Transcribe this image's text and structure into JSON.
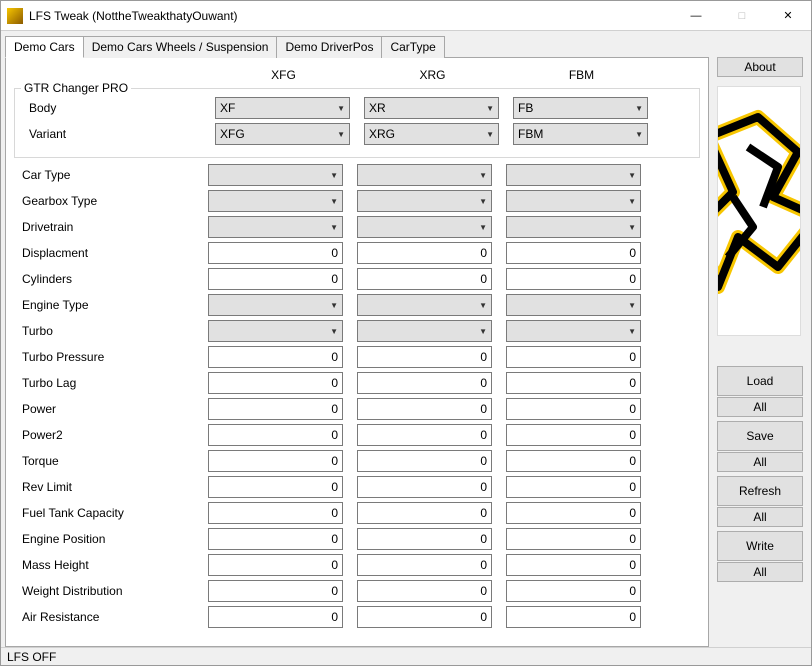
{
  "window": {
    "title": "LFS Tweak (NottheTweakthatyOuwant)"
  },
  "tabs": [
    "Demo Cars",
    "Demo Cars Wheels / Suspension",
    "Demo DriverPos",
    "CarType"
  ],
  "active_tab": 0,
  "columns": [
    "XFG",
    "XRG",
    "FBM"
  ],
  "group": {
    "title": "GTR Changer PRO",
    "rows": [
      {
        "label": "Body",
        "type": "combo",
        "values": [
          "XF",
          "XR",
          "FB"
        ]
      },
      {
        "label": "Variant",
        "type": "combo",
        "values": [
          "XFG",
          "XRG",
          "FBM"
        ]
      }
    ]
  },
  "rows": [
    {
      "label": "Car Type",
      "type": "combo",
      "values": [
        "",
        "",
        ""
      ]
    },
    {
      "label": "Gearbox Type",
      "type": "combo",
      "values": [
        "",
        "",
        ""
      ]
    },
    {
      "label": "Drivetrain",
      "type": "combo",
      "values": [
        "",
        "",
        ""
      ]
    },
    {
      "label": "Displacment",
      "type": "input",
      "values": [
        "0",
        "0",
        "0"
      ]
    },
    {
      "label": "Cylinders",
      "type": "input",
      "values": [
        "0",
        "0",
        "0"
      ]
    },
    {
      "label": "Engine Type",
      "type": "combo",
      "values": [
        "",
        "",
        ""
      ]
    },
    {
      "label": "Turbo",
      "type": "combo",
      "values": [
        "",
        "",
        ""
      ]
    },
    {
      "label": "Turbo Pressure",
      "type": "input",
      "values": [
        "0",
        "0",
        "0"
      ]
    },
    {
      "label": "Turbo Lag",
      "type": "input",
      "values": [
        "0",
        "0",
        "0"
      ]
    },
    {
      "label": "Power",
      "type": "input",
      "values": [
        "0",
        "0",
        "0"
      ]
    },
    {
      "label": "Power2",
      "type": "input",
      "values": [
        "0",
        "0",
        "0"
      ]
    },
    {
      "label": "Torque",
      "type": "input",
      "values": [
        "0",
        "0",
        "0"
      ]
    },
    {
      "label": "Rev Limit",
      "type": "input",
      "values": [
        "0",
        "0",
        "0"
      ]
    },
    {
      "label": "Fuel Tank Capacity",
      "type": "input",
      "values": [
        "0",
        "0",
        "0"
      ]
    },
    {
      "label": "Engine Position",
      "type": "input",
      "values": [
        "0",
        "0",
        "0"
      ]
    },
    {
      "label": "Mass Height",
      "type": "input",
      "values": [
        "0",
        "0",
        "0"
      ]
    },
    {
      "label": "Weight Distribution",
      "type": "input",
      "values": [
        "0",
        "0",
        "0"
      ]
    },
    {
      "label": "Air Resistance",
      "type": "input",
      "values": [
        "0",
        "0",
        "0"
      ]
    }
  ],
  "sidebar": {
    "about": "About",
    "buttons": [
      {
        "main": "Load",
        "sub": "All"
      },
      {
        "main": "Save",
        "sub": "All"
      },
      {
        "main": "Refresh",
        "sub": "All"
      },
      {
        "main": "Write",
        "sub": "All"
      }
    ]
  },
  "status": "LFS OFF"
}
